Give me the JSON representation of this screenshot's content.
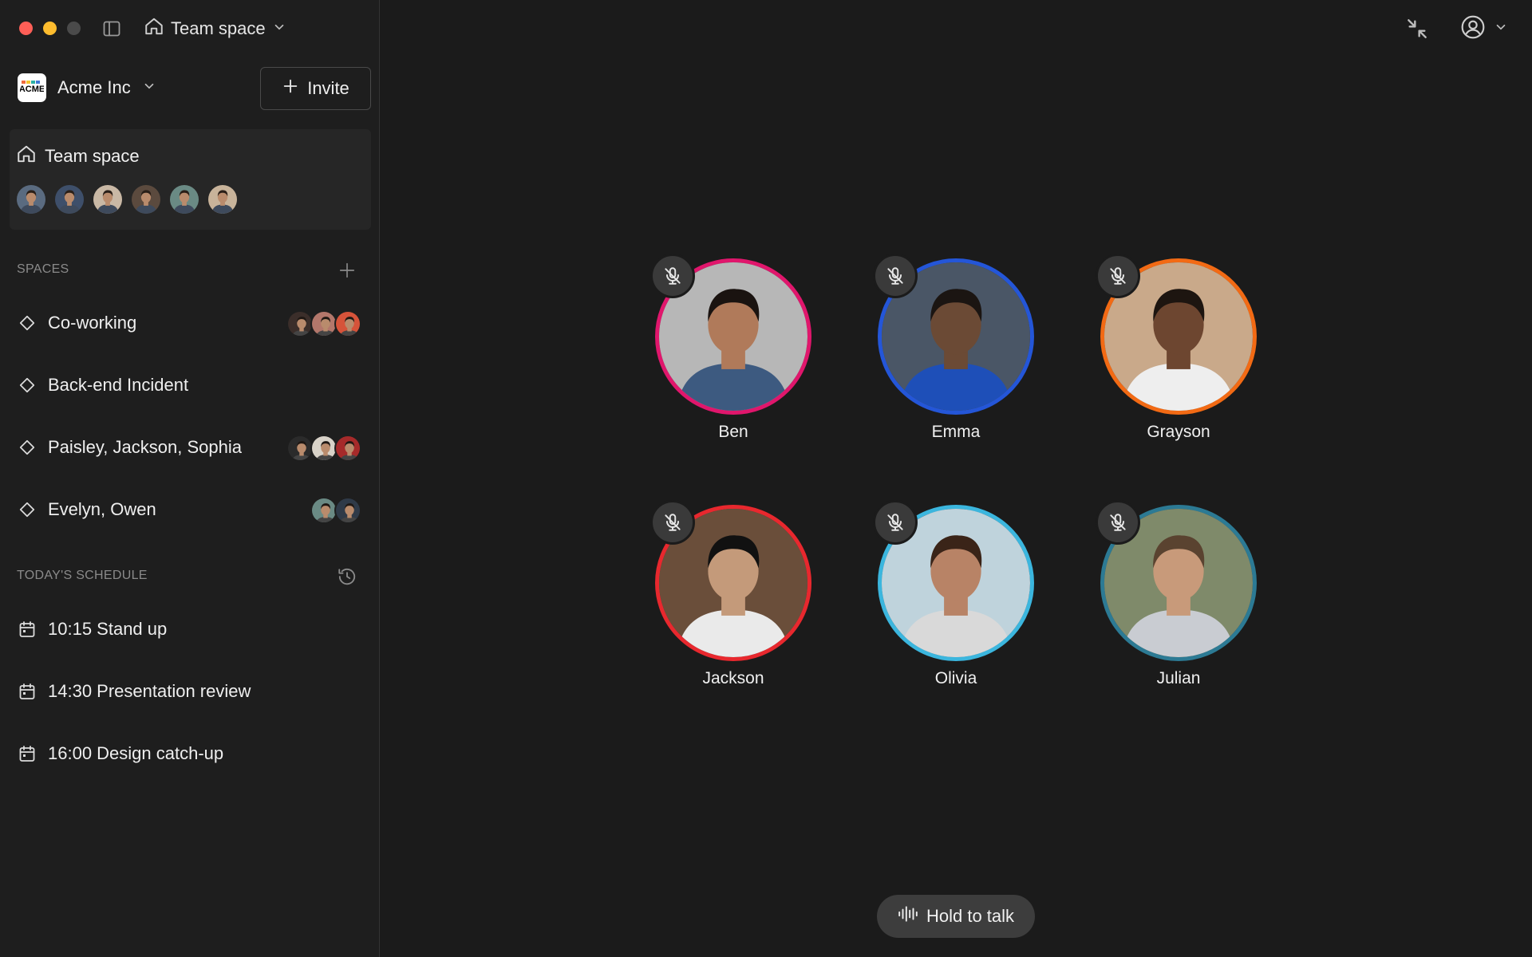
{
  "titlebar": {
    "space_switcher_label": "Team space"
  },
  "workspace": {
    "name": "Acme Inc",
    "logo_text": "ACME",
    "invite_label": "Invite"
  },
  "team_space": {
    "title": "Team space",
    "member_colors": [
      "#5a6b80",
      "#3e4f6a",
      "#c9b8a5",
      "#5b4a3e",
      "#6a8a84",
      "#c8b39a"
    ]
  },
  "spaces": {
    "header": "SPACES",
    "items": [
      {
        "label": "Co-working",
        "avatar_colors": [
          "#3b2e2a",
          "#b3776b",
          "#d6533a"
        ]
      },
      {
        "label": "Back-end Incident",
        "avatar_colors": []
      },
      {
        "label": "Paisley, Jackson, Sophia",
        "avatar_colors": [
          "#2b2b2b",
          "#d8d2c8",
          "#a62a2a"
        ]
      },
      {
        "label": "Evelyn, Owen",
        "avatar_colors": [
          "#6a8a84",
          "#2f3a48"
        ]
      }
    ]
  },
  "schedule": {
    "header": "TODAY'S SCHEDULE",
    "items": [
      {
        "label": "10:15 Stand up"
      },
      {
        "label": "14:30 Presentation review"
      },
      {
        "label": "16:00 Design catch-up"
      }
    ]
  },
  "participants": [
    {
      "name": "Ben",
      "ring_color": "#e0166c",
      "skin": "#b07a5a",
      "hair": "#1a1310",
      "shirt": "#3d5a80",
      "bg": "#b7b7b7",
      "muted": true
    },
    {
      "name": "Emma",
      "ring_color": "#2456d8",
      "skin": "#6b4a35",
      "hair": "#1b1512",
      "shirt": "#1e4fb8",
      "bg": "#4a5666",
      "muted": true
    },
    {
      "name": "Grayson",
      "ring_color": "#f26a14",
      "skin": "#6d4630",
      "hair": "#1d1510",
      "shirt": "#eeeeee",
      "bg": "#c9a98a",
      "muted": true
    },
    {
      "name": "Jackson",
      "ring_color": "#e8282e",
      "skin": "#c49a7a",
      "hair": "#111111",
      "shirt": "#eaeaea",
      "bg": "#6a4e3a",
      "muted": true
    },
    {
      "name": "Olivia",
      "ring_color": "#3bb6de",
      "skin": "#b88366",
      "hair": "#3a2418",
      "shirt": "#d9d9d9",
      "bg": "#bfd3dc",
      "muted": true
    },
    {
      "name": "Julian",
      "ring_color": "#2c7a94",
      "skin": "#c89a7a",
      "hair": "#5a4330",
      "shirt": "#c9ccd2",
      "bg": "#7f8a6a",
      "muted": true
    }
  ],
  "hold_to_talk": {
    "label": "Hold to talk"
  }
}
